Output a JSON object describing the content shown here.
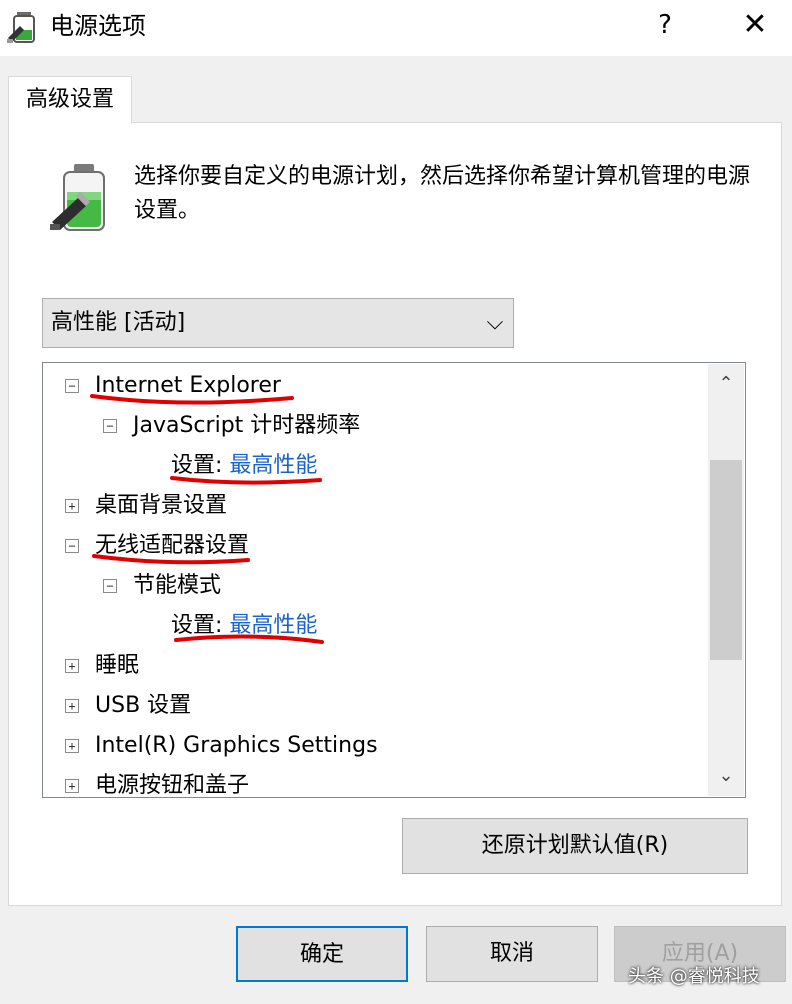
{
  "window": {
    "title": "电源选项",
    "help_glyph": "?",
    "close_glyph": "✕"
  },
  "tab": {
    "label": "高级设置"
  },
  "description": "选择你要自定义的电源计划，然后选择你希望计算机管理的电源设置。",
  "plan_select": {
    "value": "高性能 [活动]",
    "arrow_glyph": "⌵"
  },
  "tree": {
    "items": [
      {
        "label": "Internet Explorer",
        "expander": "−"
      },
      {
        "label": "JavaScript 计时器频率",
        "expander": "−"
      },
      {
        "setting_label": "设置:",
        "setting_value": "最高性能"
      },
      {
        "label": "桌面背景设置",
        "expander": "+"
      },
      {
        "label": "无线适配器设置",
        "expander": "−"
      },
      {
        "label": "节能模式",
        "expander": "−"
      },
      {
        "setting_label": "设置:",
        "setting_value": "最高性能"
      },
      {
        "label": "睡眠",
        "expander": "+"
      },
      {
        "label": "USB 设置",
        "expander": "+"
      },
      {
        "label": "Intel(R) Graphics Settings",
        "expander": "+"
      },
      {
        "label": "电源按钮和盖子",
        "expander": "+"
      }
    ]
  },
  "scrollbar": {
    "up_glyph": "⌃",
    "down_glyph": "⌄"
  },
  "restore_button": "还原计划默认值(R)",
  "buttons": {
    "ok": "确定",
    "cancel": "取消",
    "apply": "应用(A)"
  },
  "watermark": "头条 @睿悦科技",
  "colors": {
    "link": "#1a63c9",
    "annotation": "#e00000",
    "focus": "#0078d7"
  }
}
